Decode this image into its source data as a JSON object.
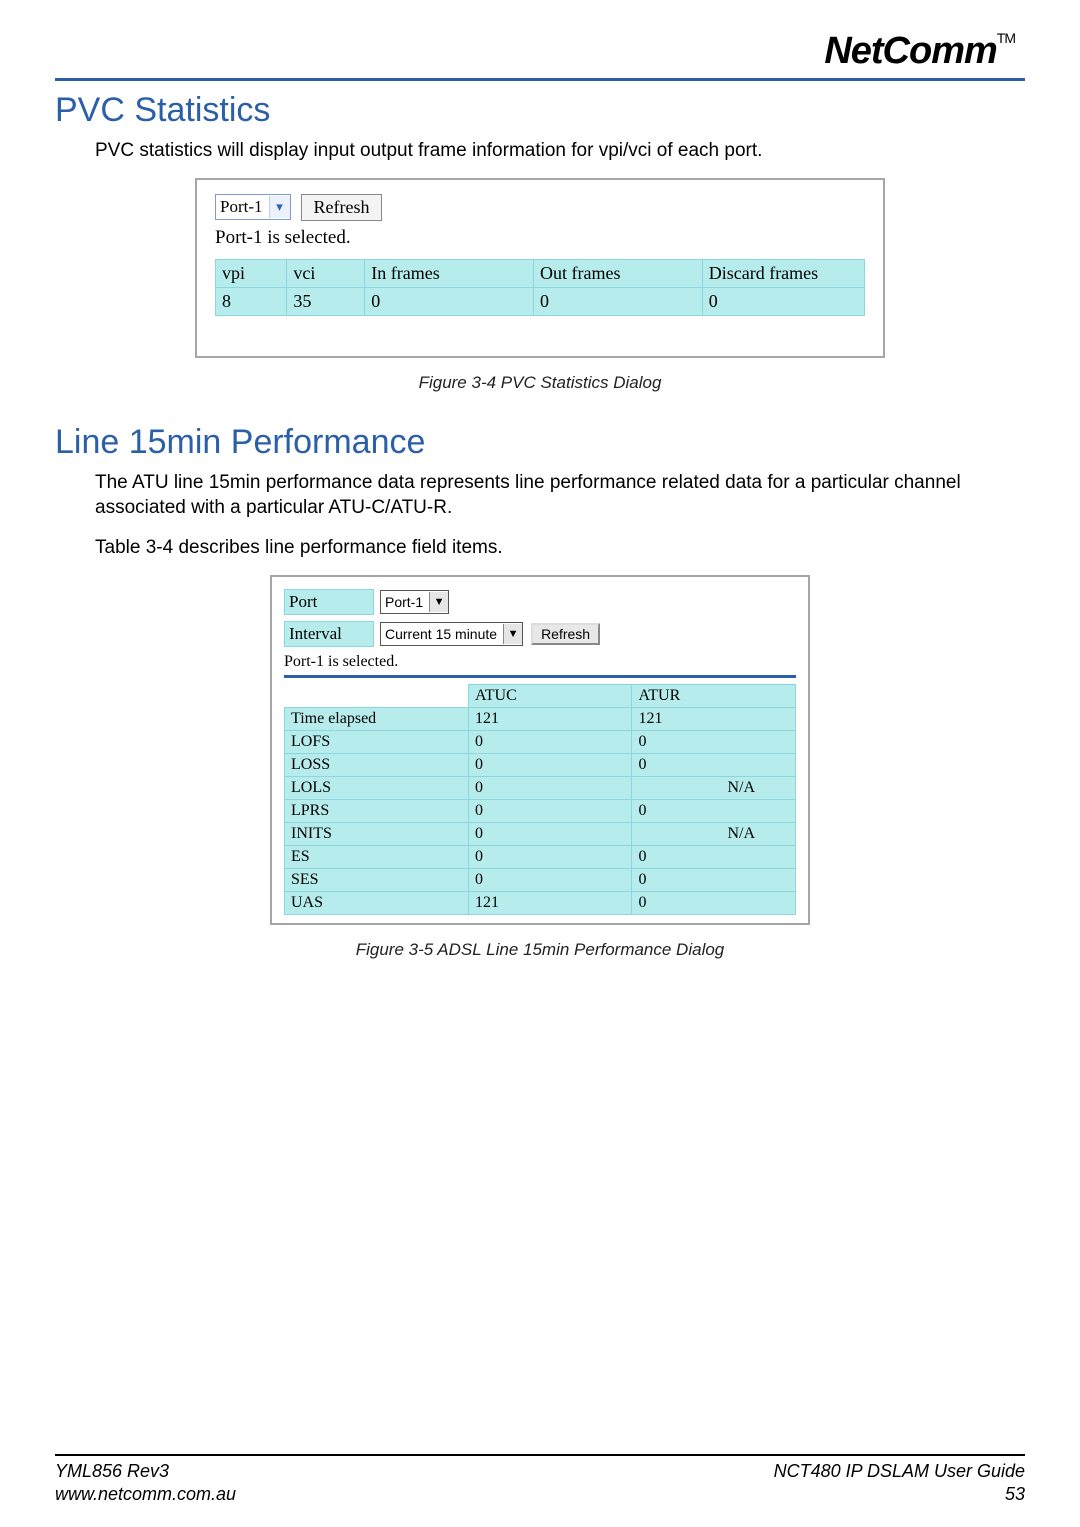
{
  "brand": "NetComm",
  "trademark": "TM",
  "section1": {
    "title": "PVC Statistics",
    "intro": "PVC statistics will display input output frame information for vpi/vci of each port.",
    "dialog": {
      "port_value": "Port-1",
      "refresh_label": "Refresh",
      "selected_text": "Port-1 is selected.",
      "headers": [
        "vpi",
        "vci",
        "In frames",
        "Out frames",
        "Discard frames"
      ],
      "row": [
        "8",
        "35",
        "0",
        "0",
        "0"
      ]
    },
    "caption": "Figure 3-4 PVC Statistics Dialog"
  },
  "section2": {
    "title": "Line 15min Performance",
    "intro": "The ATU line 15min performance data represents line performance related data for a particular channel associated with a particular ATU-C/ATU-R.",
    "note": "Table 3-4 describes line performance field items.",
    "dialog": {
      "port_label": "Port",
      "port_value": "Port-1",
      "interval_label": "Interval",
      "interval_value": "Current 15 minute",
      "refresh_label": "Refresh",
      "selected_text": "Port-1 is selected.",
      "cols": [
        "ATUC",
        "ATUR"
      ],
      "rows": [
        {
          "label": "Time elapsed",
          "atuc": "121",
          "atur": "121"
        },
        {
          "label": "LOFS",
          "atuc": "0",
          "atur": "0"
        },
        {
          "label": "LOSS",
          "atuc": "0",
          "atur": "0"
        },
        {
          "label": "LOLS",
          "atuc": "0",
          "atur": "N/A",
          "atur_right": true
        },
        {
          "label": "LPRS",
          "atuc": "0",
          "atur": "0"
        },
        {
          "label": "INITS",
          "atuc": "0",
          "atur": "N/A",
          "atur_right": true
        },
        {
          "label": "ES",
          "atuc": "0",
          "atur": "0"
        },
        {
          "label": "SES",
          "atuc": "0",
          "atur": "0"
        },
        {
          "label": "UAS",
          "atuc": "121",
          "atur": "0"
        }
      ]
    },
    "caption": "Figure 3-5 ADSL Line 15min Performance Dialog"
  },
  "footer": {
    "left_top": "YML856 Rev3",
    "left_bottom": "www.netcomm.com.au",
    "right_top": "NCT480 IP DSLAM User Guide",
    "right_bottom": "53"
  }
}
